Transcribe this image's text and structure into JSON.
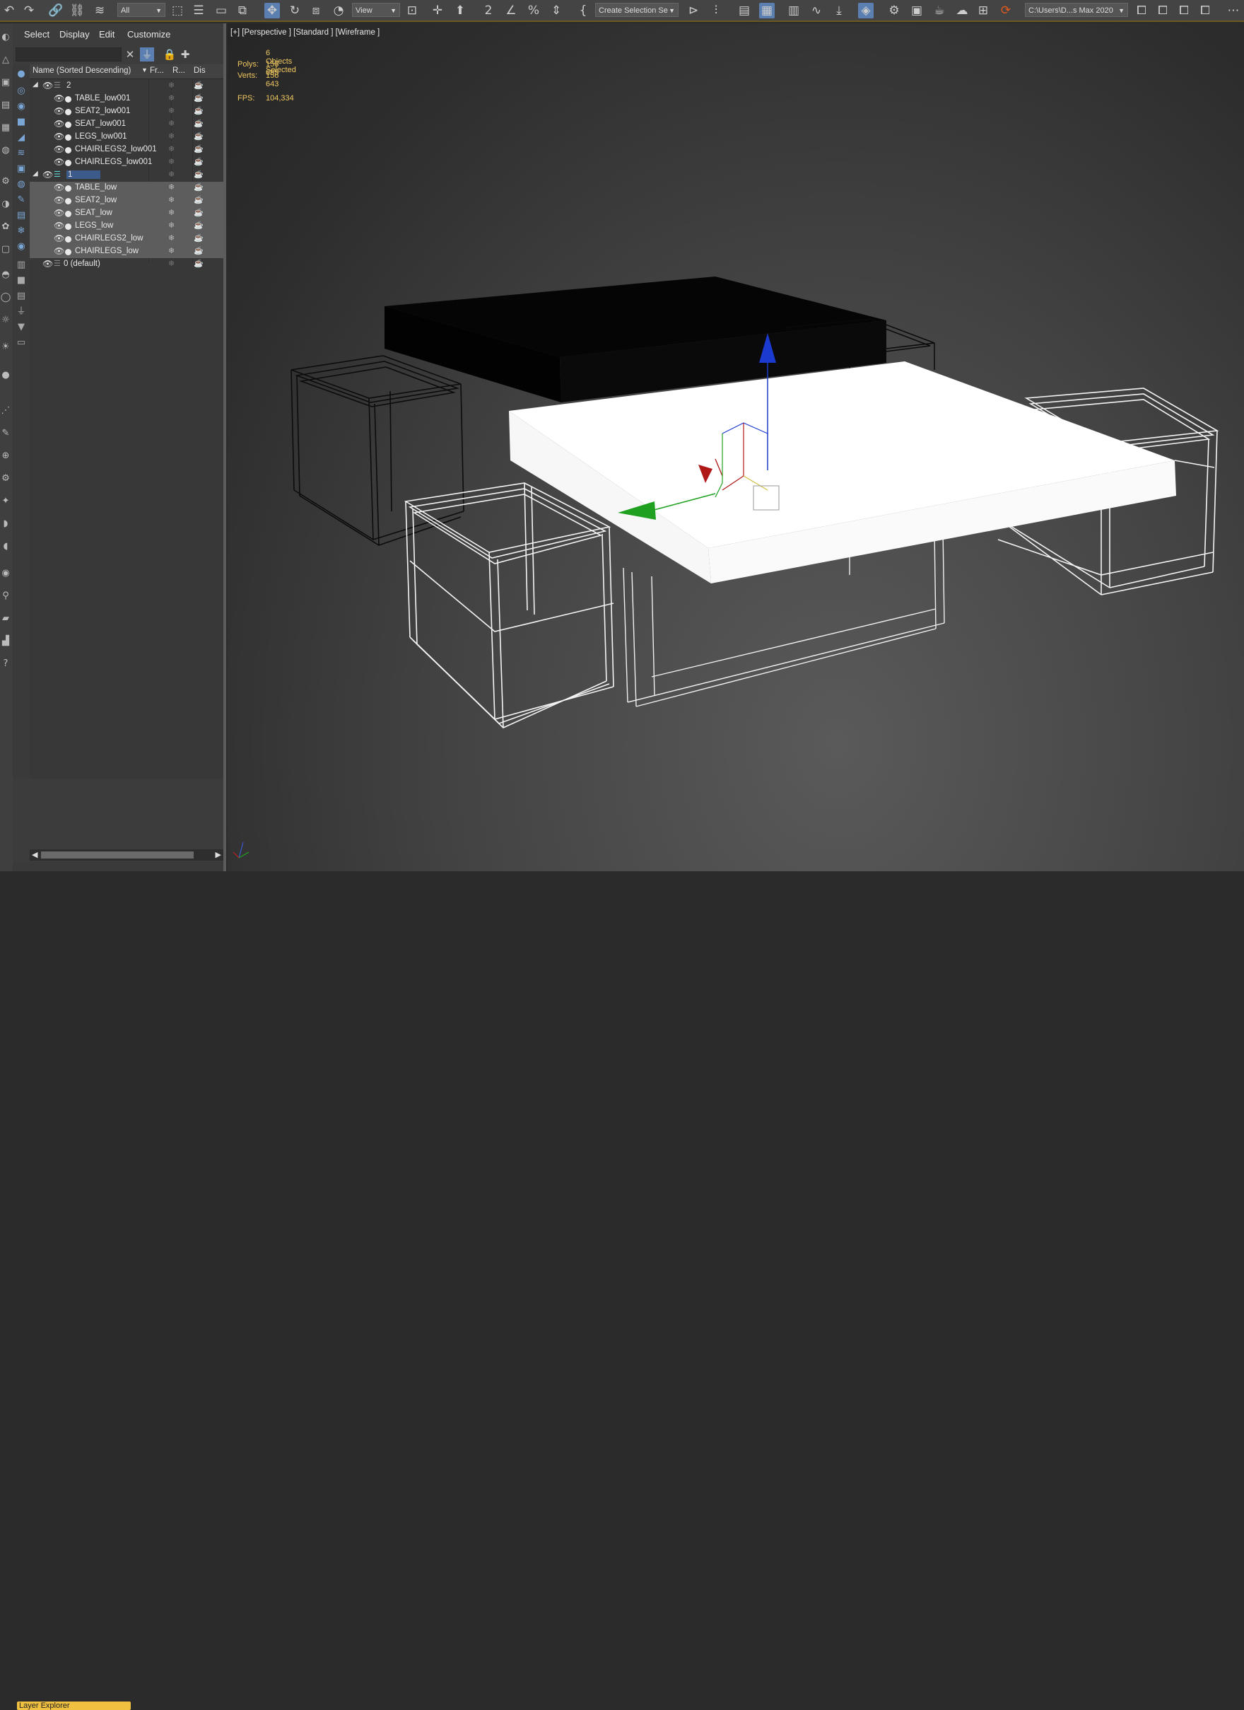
{
  "toolbar": {
    "filter_select": "All",
    "ref_coord": "View",
    "selection_set": "Create Selection Se",
    "project_path": "C:\\Users\\D...s Max 2020"
  },
  "explorer": {
    "menu": [
      "Select",
      "Display",
      "Edit",
      "Customize"
    ],
    "columns": [
      "Name (Sorted Descending)",
      "Fr...",
      "R...",
      "Dis"
    ],
    "rows": [
      {
        "name": "2",
        "kind": "layer"
      },
      {
        "name": "TABLE_low001",
        "kind": "object"
      },
      {
        "name": "SEAT2_low001",
        "kind": "object"
      },
      {
        "name": "SEAT_low001",
        "kind": "object"
      },
      {
        "name": "LEGS_low001",
        "kind": "object"
      },
      {
        "name": "CHAIRLEGS2_low001",
        "kind": "object"
      },
      {
        "name": "CHAIRLEGS_low001",
        "kind": "object"
      },
      {
        "name": "1",
        "kind": "layer-active"
      },
      {
        "name": "TABLE_low",
        "kind": "object-selected"
      },
      {
        "name": "SEAT2_low",
        "kind": "object-selected"
      },
      {
        "name": "SEAT_low",
        "kind": "object-selected"
      },
      {
        "name": "LEGS_low",
        "kind": "object-selected"
      },
      {
        "name": "CHAIRLEGS2_low",
        "kind": "object-selected"
      },
      {
        "name": "CHAIRLEGS_low",
        "kind": "object-selected"
      },
      {
        "name": "0 (default)",
        "kind": "layer-default"
      }
    ],
    "footer_mode": "Layer Explorer"
  },
  "viewport": {
    "label": "[+] [Perspective ] [Standard ] [Wireframe ]",
    "selection_info": "6 Objects Selected",
    "polys_label": "Polys:",
    "polys": "156 685",
    "verts_label": "Verts:",
    "verts": "156 643",
    "fps_label": "FPS:",
    "fps": "104,334"
  },
  "colors": {
    "toolbar_accent": "#5b7fb0",
    "stats_text": "#f0c860",
    "layer_explorer_tab": "#f0c040",
    "gizmo_x": "#cc2020",
    "gizmo_y": "#20a020",
    "gizmo_z": "#1a3ad0"
  }
}
